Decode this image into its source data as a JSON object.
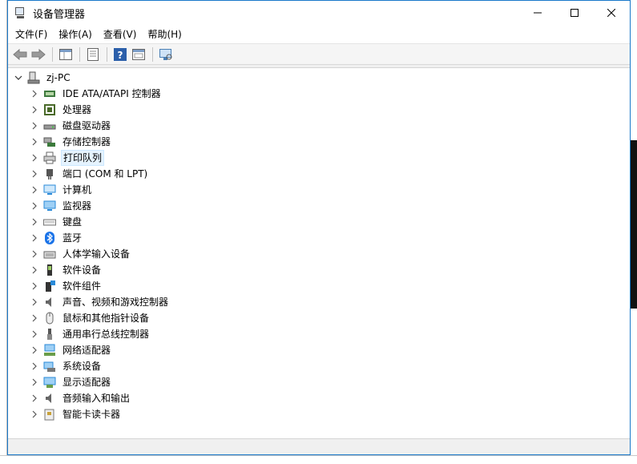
{
  "window": {
    "title": "设备管理器",
    "minimize": "—",
    "maximize": "☐",
    "close": "✕"
  },
  "menu": [
    "文件(F)",
    "操作(A)",
    "查看(V)",
    "帮助(H)"
  ],
  "toolbar": [
    "back-icon",
    "forward-icon",
    "properties-pane-icon",
    "list-icon",
    "help-icon",
    "show-hide-icon",
    "monitor-scan-icon"
  ],
  "tree": {
    "root": "zj-PC",
    "items": [
      {
        "label": "IDE ATA/ATAPI 控制器",
        "icon": "ide-controller-icon",
        "color": "#3f7a3f"
      },
      {
        "label": "处理器",
        "icon": "processor-icon",
        "color": "#4a6a2a"
      },
      {
        "label": "磁盘驱动器",
        "icon": "disk-drive-icon",
        "color": "#555555"
      },
      {
        "label": "存储控制器",
        "icon": "storage-controller-icon",
        "color": "#3b7a3b"
      },
      {
        "label": "打印队列",
        "icon": "printer-icon",
        "color": "#666666",
        "selected": true
      },
      {
        "label": "端口 (COM 和 LPT)",
        "icon": "port-icon",
        "color": "#555555"
      },
      {
        "label": "计算机",
        "icon": "computer-icon",
        "color": "#2a8ad8"
      },
      {
        "label": "监视器",
        "icon": "monitor-icon",
        "color": "#2a8ad8"
      },
      {
        "label": "键盘",
        "icon": "keyboard-icon",
        "color": "#777777"
      },
      {
        "label": "蓝牙",
        "icon": "bluetooth-icon",
        "color": "#1a73e8"
      },
      {
        "label": "人体学输入设备",
        "icon": "hid-icon",
        "color": "#666666"
      },
      {
        "label": "软件设备",
        "icon": "software-device-icon",
        "color": "#333333"
      },
      {
        "label": "软件组件",
        "icon": "software-component-icon",
        "color": "#333333"
      },
      {
        "label": "声音、视频和游戏控制器",
        "icon": "speaker-icon",
        "color": "#666666"
      },
      {
        "label": "鼠标和其他指针设备",
        "icon": "mouse-icon",
        "color": "#666666"
      },
      {
        "label": "通用串行总线控制器",
        "icon": "usb-icon",
        "color": "#555555"
      },
      {
        "label": "网络适配器",
        "icon": "network-adapter-icon",
        "color": "#2a8ad8"
      },
      {
        "label": "系统设备",
        "icon": "system-device-icon",
        "color": "#2a8ad8"
      },
      {
        "label": "显示适配器",
        "icon": "display-adapter-icon",
        "color": "#2a8ad8"
      },
      {
        "label": "音频输入和输出",
        "icon": "audio-io-icon",
        "color": "#666666"
      },
      {
        "label": "智能卡读卡器",
        "icon": "smart-card-reader-icon",
        "color": "#777777"
      }
    ]
  }
}
